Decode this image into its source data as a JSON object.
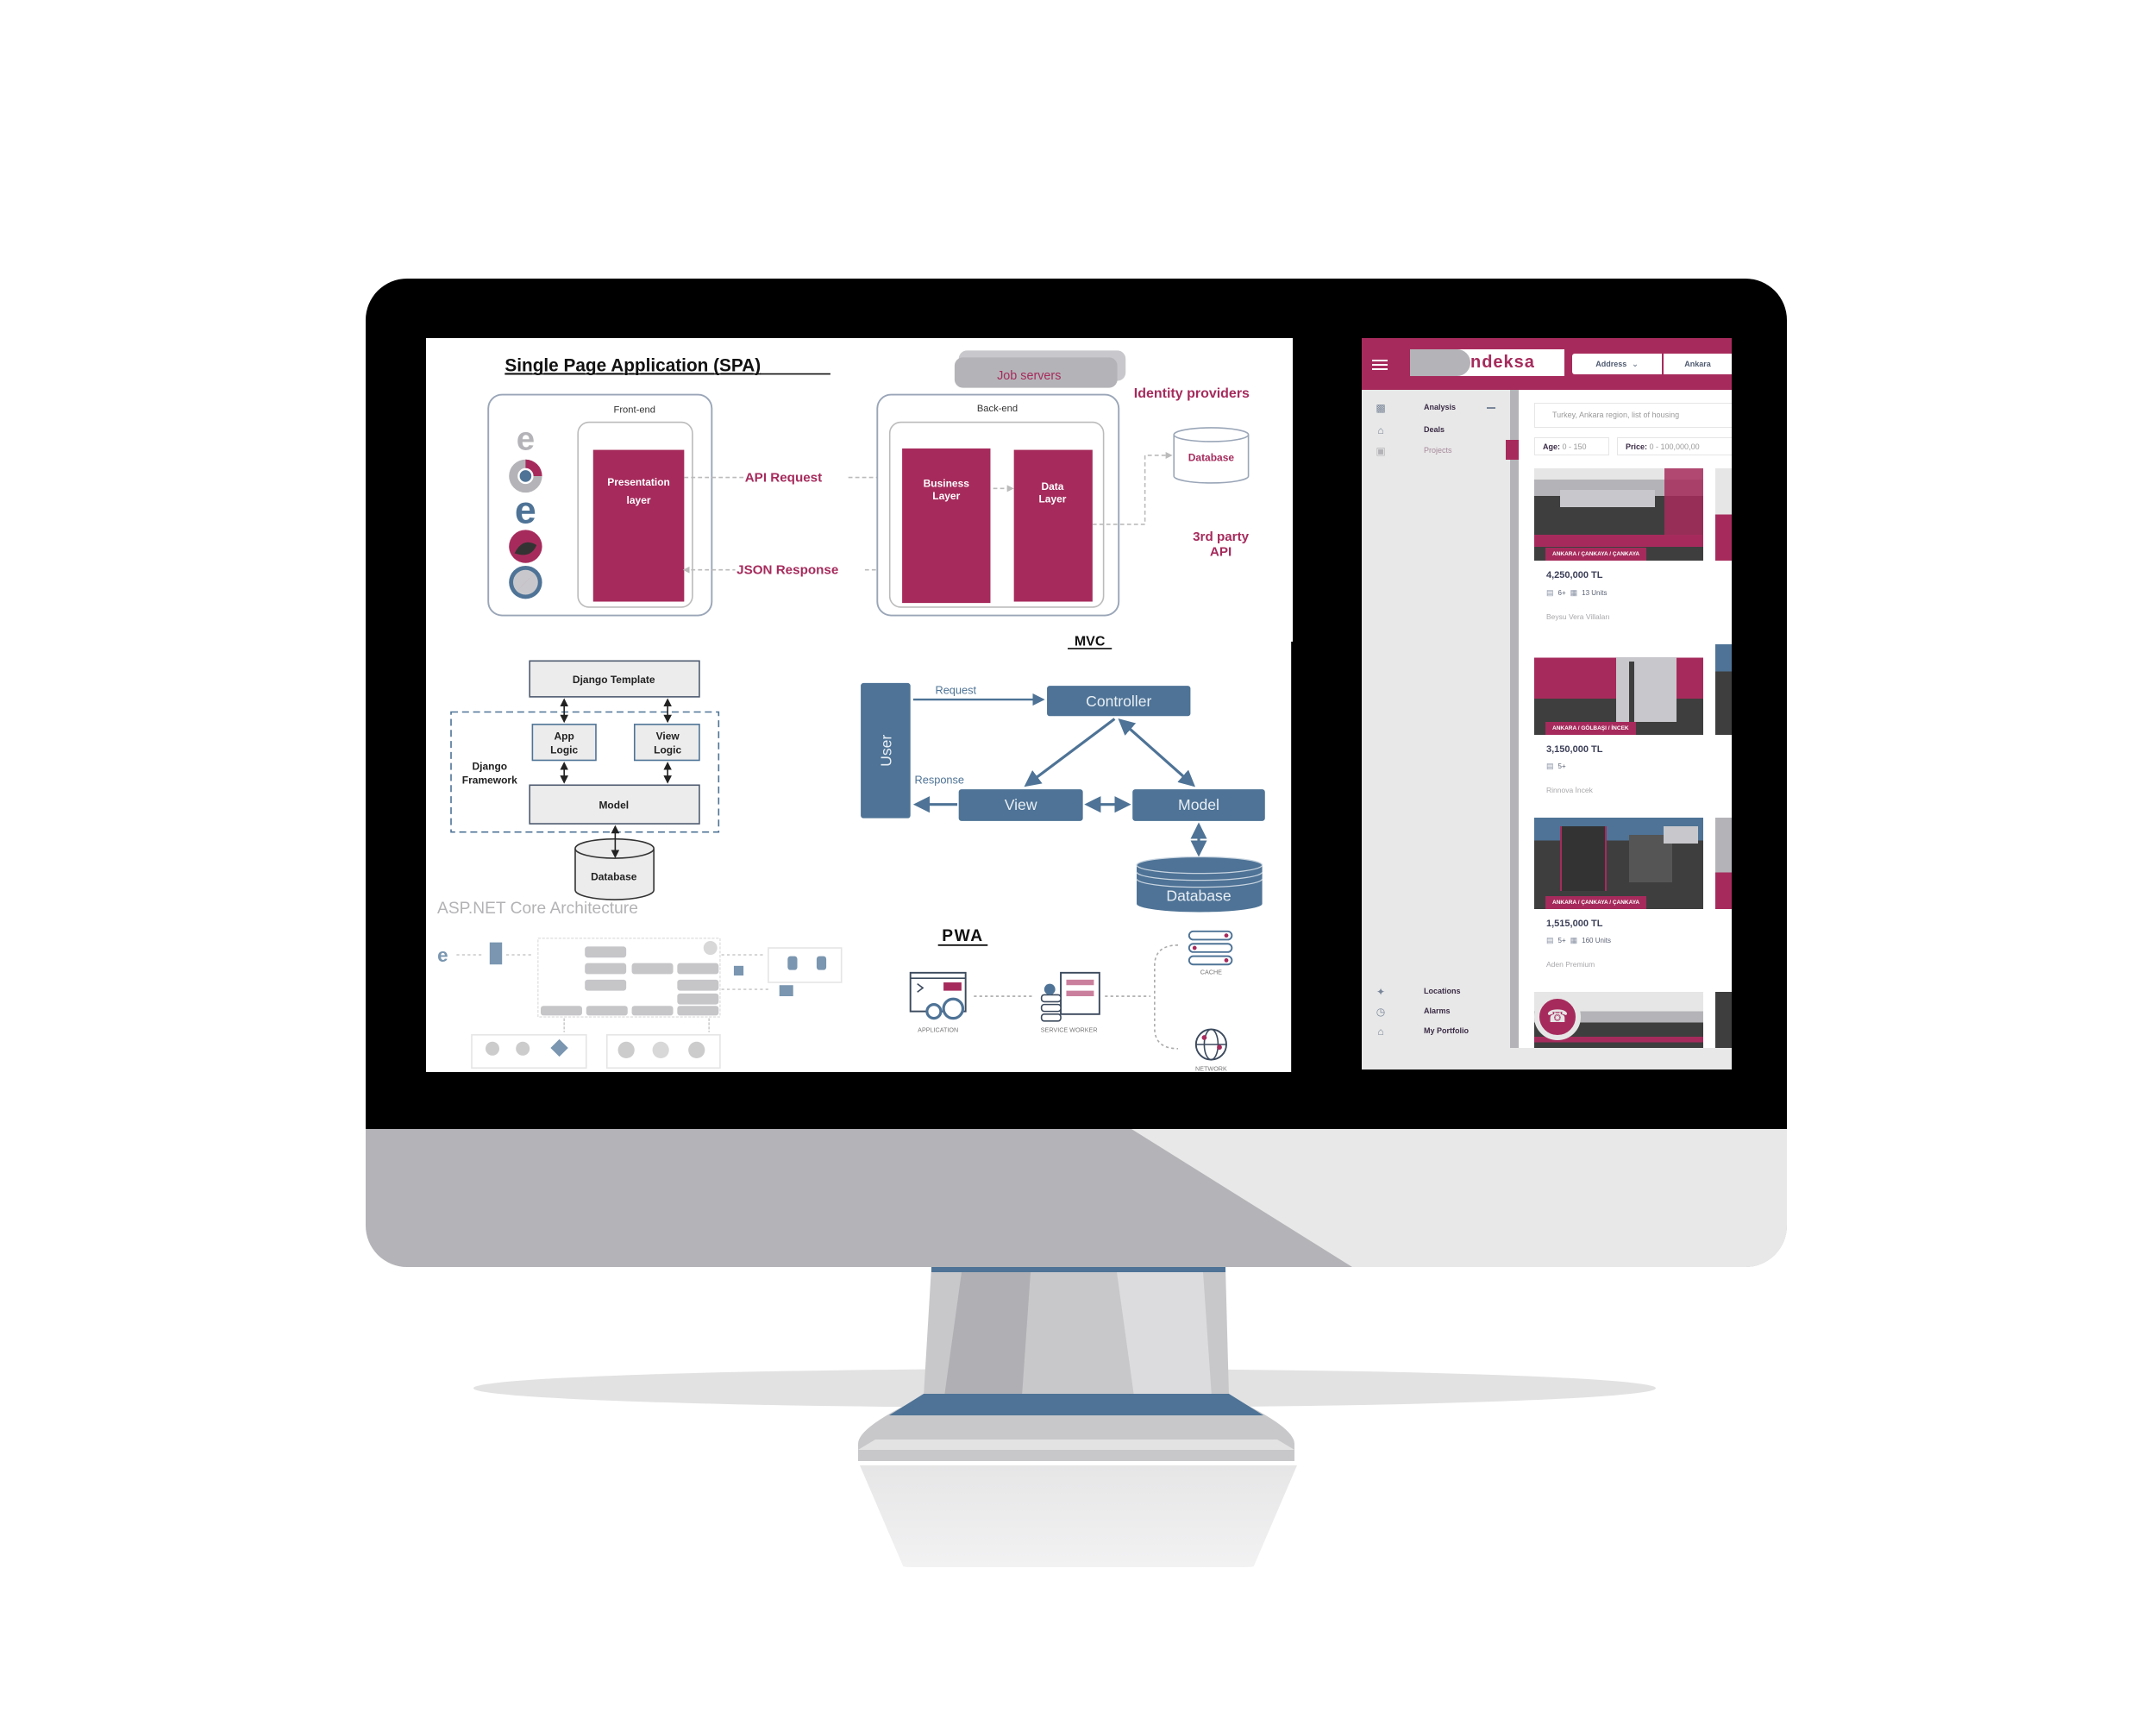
{
  "spa": {
    "title": "Single Page Application (SPA)",
    "job_servers": "Job servers",
    "identity_providers": "Identity providers",
    "frontend": "Front-end",
    "backend": "Back-end",
    "presentation": [
      "Presentation",
      "layer"
    ],
    "business": [
      "Business",
      "Layer"
    ],
    "data_layer": [
      "Data",
      "Layer"
    ],
    "api_request": "API Request",
    "json_response": "JSON Response",
    "database": "Database",
    "third_party": [
      "3rd party",
      "API"
    ],
    "browser_icons": [
      "internet-explorer-icon",
      "chrome-icon",
      "edge-icon",
      "firefox-icon",
      "safari-icon"
    ]
  },
  "django": {
    "template": "Django Template",
    "app_logic": [
      "App",
      "Logic"
    ],
    "view_logic": [
      "View",
      "Logic"
    ],
    "framework": [
      "Django",
      "Framework"
    ],
    "model": "Model",
    "database": "Database"
  },
  "aspnet": {
    "title": "ASP.NET Core Architecture"
  },
  "mvc": {
    "title": "MVC",
    "user": "User",
    "controller": "Controller",
    "view": "View",
    "model": "Model",
    "database": "Database",
    "request": "Request",
    "response": "Response"
  },
  "pwa": {
    "title": "PWA",
    "application": "APPLICATION",
    "service_worker": "SERVICE WORKER",
    "cache": "CACHE",
    "network": "NETWORK"
  },
  "app": {
    "logo": "ndeksa",
    "address_label": "Address",
    "city": "Ankara",
    "sidebar_top": [
      {
        "label": "Analysis",
        "icon": "bar-chart-icon"
      },
      {
        "label": "Deals",
        "icon": "house-icon"
      },
      {
        "label": "Projects",
        "icon": "building-icon"
      }
    ],
    "sidebar_bottom": [
      {
        "label": "Locations",
        "icon": "map-pin-icon"
      },
      {
        "label": "Alarms",
        "icon": "alarm-icon"
      },
      {
        "label": "My Portfolio",
        "icon": "portfolio-house-icon"
      }
    ],
    "search_text": "Turkey, Ankara region, list of housing",
    "filters": [
      {
        "label": "Age:",
        "value": "0 - 150"
      },
      {
        "label": "Price:",
        "value": "0 - 100,000,00"
      }
    ],
    "listings": [
      {
        "location": "ANKARA / ÇANKAYA / ÇANKAYA",
        "price": "4,250,000 TL",
        "rooms": "6+",
        "units": "13 Units",
        "name": "Beysu Vera Villaları"
      },
      {
        "location": "ANKARA / GÖLBAŞI / İNCEK",
        "price": "3,150,000 TL",
        "rooms": "5+",
        "units": "",
        "name": "Rinnova İncek"
      },
      {
        "location": "ANKARA / ÇANKAYA / ÇANKAYA",
        "price": "1,515,000 TL",
        "rooms": "5+",
        "units": "160 Units",
        "name": "Aden Premium"
      }
    ]
  },
  "colors": {
    "accent": "#a62b5c",
    "diagram_blue": "#4e7396",
    "monitor_gray": "#b4b4b8",
    "bezel": "#000000"
  }
}
